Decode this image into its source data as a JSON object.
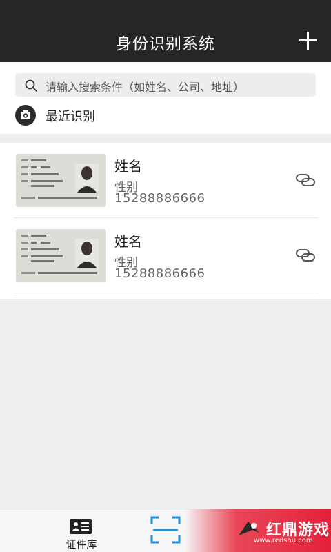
{
  "header": {
    "title": "身份识别系统"
  },
  "search": {
    "placeholder": "请输入搜索条件（如姓名、公司、地址）"
  },
  "recent": {
    "label": "最近识别"
  },
  "items": [
    {
      "name": "姓名",
      "gender": "性别",
      "phone": "15288886666"
    },
    {
      "name": "姓名",
      "gender": "性别",
      "phone": "15288886666"
    }
  ],
  "bottom_nav": {
    "id_library_label": "证件库"
  },
  "watermark": {
    "brand": "红鼎游戏",
    "url": "www.redshu.com"
  },
  "colors": {
    "header_bg": "#262626",
    "scan_accent": "#1c8fe0",
    "watermark_red": "#e3213a"
  }
}
